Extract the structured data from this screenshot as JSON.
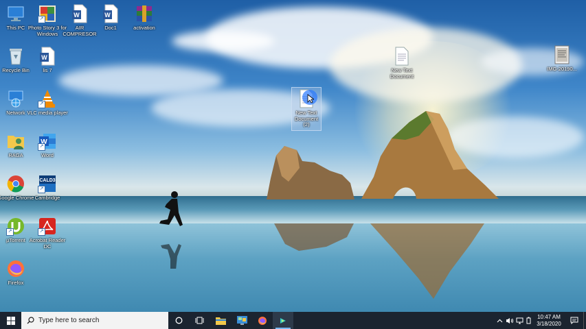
{
  "desktop_icons": [
    {
      "label": "This PC",
      "icon": "this-pc-icon"
    },
    {
      "label": "Photo Story 3 for Windows",
      "icon": "photo-story-icon"
    },
    {
      "label": "AIR COMPRESOR",
      "icon": "word-document-icon"
    },
    {
      "label": "Doc1",
      "icon": "word-document-icon"
    },
    {
      "label": "activation",
      "icon": "winrar-archive-icon"
    },
    {
      "label": "Recycle Bin",
      "icon": "recycle-bin-icon"
    },
    {
      "label": "lis 7",
      "icon": "word-document-icon"
    },
    {
      "label": "Network",
      "icon": "network-icon"
    },
    {
      "label": "VLC media player",
      "icon": "vlc-icon"
    },
    {
      "label": "RAGA",
      "icon": "user-folder-icon"
    },
    {
      "label": "Word",
      "icon": "word-app-icon"
    },
    {
      "label": "Google Chrome",
      "icon": "chrome-icon"
    },
    {
      "label": "Cambridge",
      "icon": "cald3-icon"
    },
    {
      "label": "µTorrent",
      "icon": "utorrent-icon"
    },
    {
      "label": "Acrobat Reader DC",
      "icon": "acrobat-icon"
    },
    {
      "label": "Firefox",
      "icon": "firefox-icon"
    },
    {
      "label": "New Text Document",
      "icon": "text-document-icon"
    },
    {
      "label": "IMG-20190...",
      "icon": "image-file-icon"
    },
    {
      "label": "New Text Document (2)",
      "icon": "text-document-icon"
    }
  ],
  "taskbar": {
    "search_placeholder": "Type here to search",
    "clock_time": "10:47 AM",
    "clock_date": "3/18/2020",
    "pinned": [
      "cortana-icon",
      "task-view-icon",
      "file-explorer-icon",
      "control-panel-icon",
      "firefox-icon",
      "visual-studio-code-icon"
    ]
  },
  "colors": {
    "taskbar": "#1b2430",
    "accent": "#79b8f3"
  }
}
